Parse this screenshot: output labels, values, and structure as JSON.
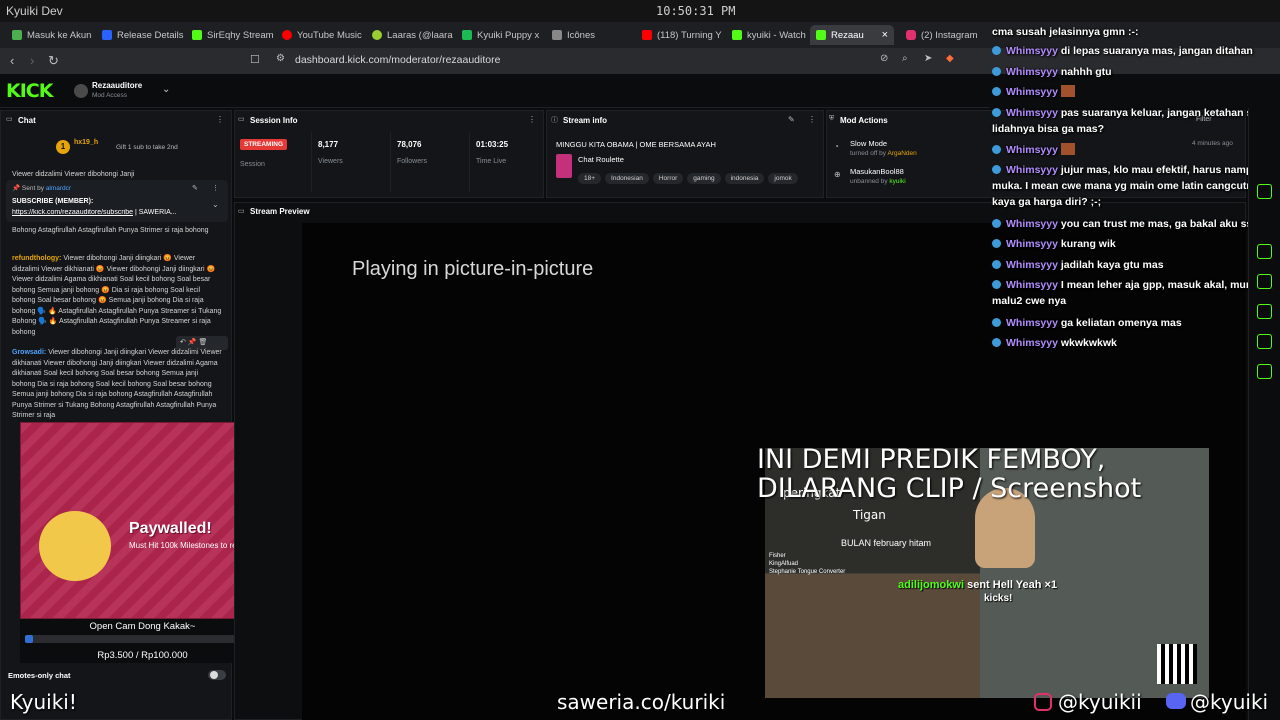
{
  "os": {
    "title": "Kyuiki Dev",
    "clock": "10:50:31 PM"
  },
  "tabs": [
    {
      "label": "Masuk ke Akun",
      "color": "#4caf50"
    },
    {
      "label": "Release Details",
      "color": "#2962ff"
    },
    {
      "label": "SirEqhy Stream",
      "color": "#53fc18"
    },
    {
      "label": "YouTube Music",
      "color": "#ff0000"
    },
    {
      "label": "Laaras (@laara",
      "color": "#9acd32"
    },
    {
      "label": "Kyuiki Puppy x",
      "color": "#1db954"
    },
    {
      "label": "Icônes",
      "color": "#888888"
    },
    {
      "label": "(118) Turning Y",
      "color": "#ff0000"
    },
    {
      "label": "kyuiki - Watch",
      "color": "#53fc18"
    },
    {
      "label": "Rezaau",
      "color": "#53fc18"
    },
    {
      "label": "(2) Instagram",
      "color": "#e1306c"
    }
  ],
  "url": "dashboard.kick.com/moderator/rezaauditore",
  "channel": {
    "name": "Rezaauditore",
    "role": "Mod Access"
  },
  "chat": {
    "title": "Chat",
    "gift_user": "hx19_h",
    "gift_text": "Gift 1 sub to take 2nd",
    "gift_rank": "1",
    "pinned_sender_label": "Sent by",
    "pinned_sender": "almardcr",
    "pinned_title": "SUBSCRIBE (MEMBER):",
    "pinned_link": "https://kick.com/rezaauditore/subscribe",
    "pinned_tail": "| SAWERIA...",
    "top_fragment": "Viewer didzalimi Viewer dibohongi Janji",
    "msg1": "Bohong Astagfirullah Astagfirullah Punya Strimer si raja bohong",
    "msg2_user": "refundthology:",
    "msg2": "Viewer dibohongi Janji diingkari 😡 Viewer didzalimi Viewer dikhianati 😡 Viewer dibohongi Janji diingkari 😡 Viewer didzalimi Agama dikhianati Soal kecil bohong Soal besar bohong Semua janji bohong 😡 Dia si raja bohong Soal kecil bohong Soal besar bohong 😡 Semua janji bohong Dia si raja bohong 🗣️ 🔥 Astagfirullah Astagfirullah Punya Streamer si Tukang Bohong 🗣️ 🔥 Astagfirullah Astagfirullah Punya Streamer si raja bohong",
    "msg3_user": "Growsadi:",
    "msg3": "Viewer dibohongi Janji diingkari Viewer didzalimi Viewer dikhianati Viewer dibohongi Janji diingkari Viewer didzalimi Agama dikhianati Soal kecil bohong Soal besar bohong Semua janji bohong Dia si raja bohong Soal kecil bohong Soal besar bohong Semua janji bohong Dia si raja bohong Astagfirullah Astagfirullah Punya Strimer si Tukang Bohong Astagfirullah Astagfirullah Punya Strimer si raja",
    "emotes_only": "Emotes-only chat"
  },
  "session": {
    "title": "Session Info",
    "status": "STREAMING",
    "status_label": "Session",
    "viewers": "8,177",
    "viewers_label": "Viewers",
    "followers": "78,076",
    "followers_label": "Followers",
    "time": "01:03:25",
    "time_label": "Time Live"
  },
  "stream_info": {
    "title": "Stream info",
    "stream_title": "MINGGU KITA OBAMA | OME BERSAMA AYAH",
    "category": "Chat Roulette",
    "tags": [
      "18+",
      "Indonesian",
      "Horror",
      "gaming",
      "indonesia",
      "jomok"
    ]
  },
  "mod_actions": {
    "title": "Mod Actions",
    "filter_label": "Filter",
    "a1_title": "Slow Mode",
    "a1_prefix": "turned off by",
    "a1_user": "ArgaNden",
    "a1_time": "4 minutes ago",
    "a2_title": "MasukanBool88",
    "a2_prefix": "unbanned by",
    "a2_user": "kyuiki"
  },
  "preview": {
    "title": "Stream Preview",
    "pip": "Playing in picture-in-picture"
  },
  "overlay_chat": {
    "top_fragment": "cma susah jelasinnya gmn :-:",
    "user": "Whimsyyy",
    "messages": [
      "di lepas suaranya mas, jangan ditahan",
      "nahhh gtu",
      "",
      "pas suaranya keluar, jangan ketahan sama lidahnya bisa ga mas?",
      "",
      "jujur mas, klo mau efektif, harus nampakin muka. I mean cwe mana yg main ome latin cangcutnya kaya ga harga diri? ;-;",
      "you can trust me mas, ga bakal aku ss",
      "kurang wik",
      "jadilah kaya gtu mas",
      "I mean leher aja gpp, masuk akal, mungkin malu2 cwe nya",
      "ga keliatan omenya mas",
      "wkwkwkwk"
    ]
  },
  "stream_overlay": {
    "headline": "INI DEMI PREDIK FEMBOY, DILARANG CLIP / Screenshot",
    "month_text": "BULAN february hitam",
    "peringkat": "peringkat",
    "tigan": "Tigan",
    "alert_user": "adilijomokwi",
    "alert_text": "sent Hell Yeah ×1",
    "alert_sub": "kicks!",
    "list": [
      "Fisher",
      "KingAlfuad",
      "Stephanie Tongue Converter"
    ],
    "footer_left": "Kyuiki!",
    "footer_mid": "saweria.co/kuriki",
    "footer_ig": "@kyuikii",
    "footer_dc": "@kyuiki"
  },
  "paywall": {
    "title": "Paywalled!",
    "sub": "Must Hit 100k Milestones to reveal~",
    "goal": "Open Cam Dong Kakak~",
    "amount": "Rp3.500 / Rp100.000",
    "progress": 0.035
  },
  "colors": {
    "kick_green": "#53fc18",
    "streaming_red": "#e53935",
    "paywall_pink": "#b3264f"
  }
}
